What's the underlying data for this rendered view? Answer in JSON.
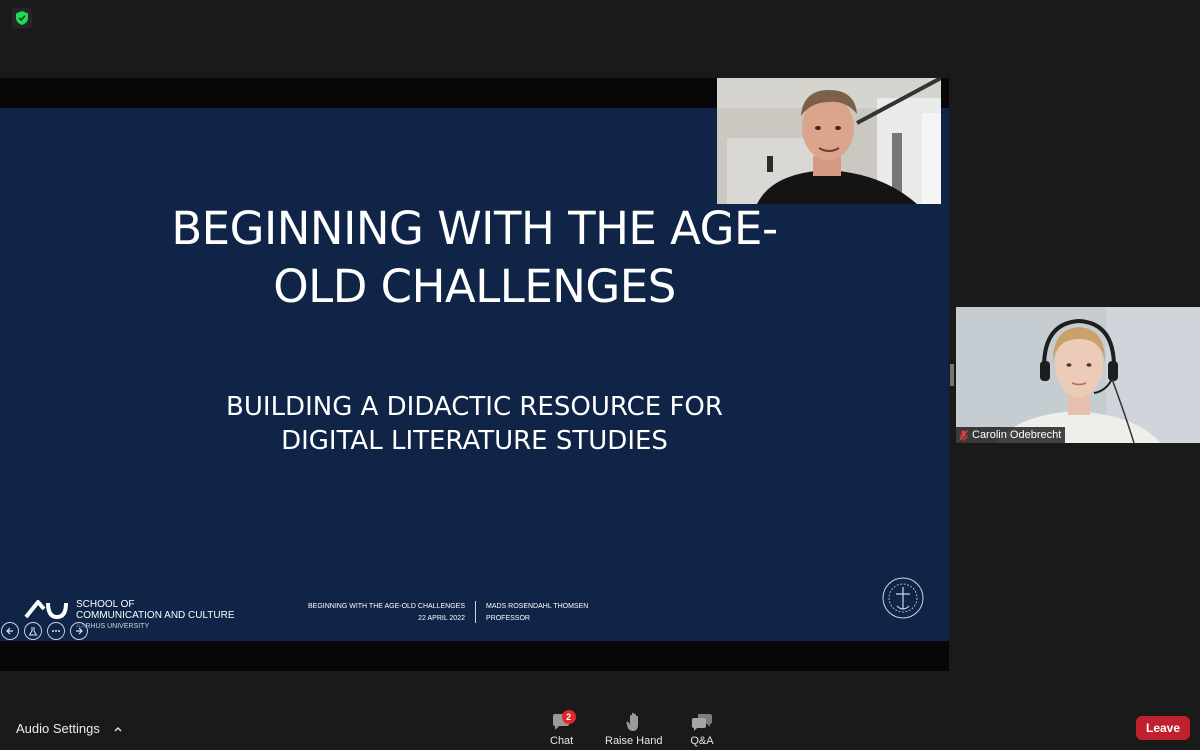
{
  "security": {
    "icon": "shield-check-icon",
    "color": "#23d959"
  },
  "slide": {
    "title_lines": [
      "BEGINNING WITH THE AGE-",
      "OLD CHALLENGES"
    ],
    "subtitle_lines": [
      "BUILDING A DIDACTIC RESOURCE FOR",
      "DIGITAL LITERATURE STUDIES"
    ],
    "school_lines": [
      "SCHOOL OF",
      "COMMUNICATION AND CULTURE"
    ],
    "university": "AARHUS UNIVERSITY",
    "footer_left": [
      "BEGINNING WITH THE AGE-OLD CHALLENGES",
      "22 APRIL 2022"
    ],
    "footer_right": [
      "MADS ROSENDAHL THOMSEN",
      "PROFESSOR"
    ],
    "background": "#0f2446"
  },
  "slide_controls": [
    "previous-icon",
    "pointer-icon",
    "more-icon",
    "next-icon"
  ],
  "participants": [
    {
      "role": "speaker-video"
    },
    {
      "name": "Carolin Odebrecht",
      "muted": true
    }
  ],
  "toolbar": {
    "audio_settings": "Audio Settings",
    "chat": {
      "label": "Chat",
      "badge": "2"
    },
    "raise_hand": "Raise Hand",
    "qa": "Q&A",
    "leave": "Leave",
    "leave_color": "#c2202c"
  }
}
